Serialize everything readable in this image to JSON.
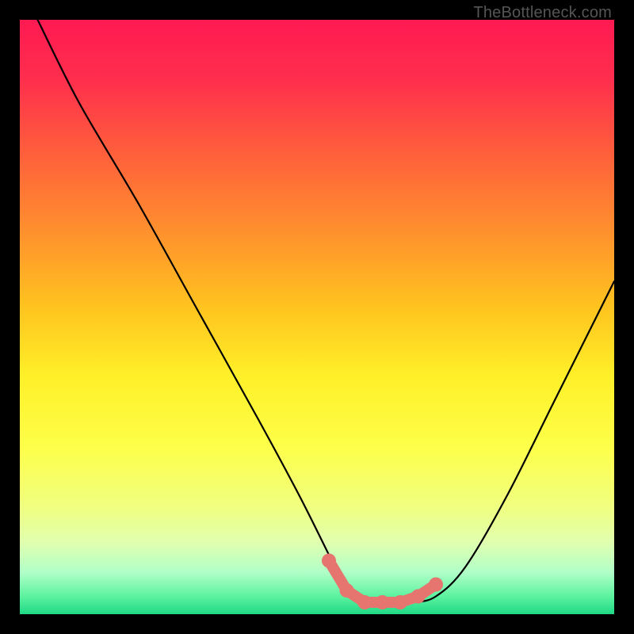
{
  "watermark": "TheBottleneck.com",
  "chart_data": {
    "type": "line",
    "title": "",
    "xlabel": "",
    "ylabel": "",
    "xlim": [
      0,
      100
    ],
    "ylim": [
      0,
      100
    ],
    "series": [
      {
        "name": "bottleneck-curve",
        "x": [
          3,
          10,
          20,
          30,
          40,
          47,
          52,
          55,
          58,
          62,
          66,
          70,
          75,
          82,
          90,
          100
        ],
        "y": [
          100,
          86,
          69,
          51,
          33,
          20,
          10,
          4,
          2,
          2,
          2,
          3,
          8,
          20,
          36,
          56
        ]
      }
    ],
    "markers": [
      {
        "name": "dot-left",
        "x": 52,
        "y": 9
      },
      {
        "name": "dot-a",
        "x": 55,
        "y": 4
      },
      {
        "name": "dot-b",
        "x": 58,
        "y": 2
      },
      {
        "name": "dot-c",
        "x": 61,
        "y": 2
      },
      {
        "name": "dot-d",
        "x": 64,
        "y": 2
      },
      {
        "name": "dot-e",
        "x": 67,
        "y": 3
      },
      {
        "name": "dot-right",
        "x": 70,
        "y": 5
      }
    ],
    "marker_color": "#e5756e",
    "curve_color": "#000000",
    "background_gradient": [
      {
        "stop": 0.0,
        "color": "#ff1a52"
      },
      {
        "stop": 0.1,
        "color": "#ff2e4d"
      },
      {
        "stop": 0.22,
        "color": "#ff5d3c"
      },
      {
        "stop": 0.35,
        "color": "#ff8e2e"
      },
      {
        "stop": 0.48,
        "color": "#ffc21f"
      },
      {
        "stop": 0.6,
        "color": "#fff028"
      },
      {
        "stop": 0.72,
        "color": "#fdff4a"
      },
      {
        "stop": 0.82,
        "color": "#f0ff80"
      },
      {
        "stop": 0.88,
        "color": "#e0ffb0"
      },
      {
        "stop": 0.93,
        "color": "#b0ffc8"
      },
      {
        "stop": 0.97,
        "color": "#5cf2a0"
      },
      {
        "stop": 1.0,
        "color": "#1fd985"
      }
    ]
  }
}
